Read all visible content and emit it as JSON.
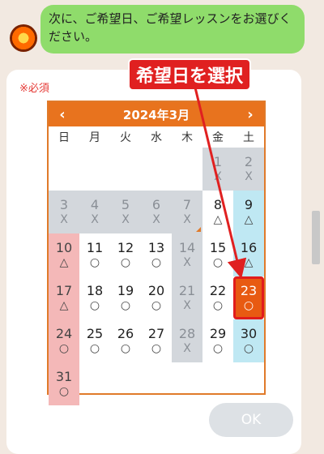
{
  "chat": {
    "message": "次に、ご希望日、ご希望レッスンをお選びください。"
  },
  "form": {
    "required_label": "※必須",
    "ok_label": "OK"
  },
  "annotation": {
    "callout": "希望日を選択"
  },
  "calendar": {
    "title": "2024年3月",
    "prev_label": "‹",
    "next_label": "›",
    "weekdays": [
      "日",
      "月",
      "火",
      "水",
      "木",
      "金",
      "土"
    ],
    "days": [
      {
        "day": "",
        "mark": "",
        "state": "empty"
      },
      {
        "day": "",
        "mark": "",
        "state": "empty"
      },
      {
        "day": "",
        "mark": "",
        "state": "empty"
      },
      {
        "day": "",
        "mark": "",
        "state": "empty"
      },
      {
        "day": "",
        "mark": "",
        "state": "empty"
      },
      {
        "day": "1",
        "mark": "X",
        "state": "gray"
      },
      {
        "day": "2",
        "mark": "X",
        "state": "gray"
      },
      {
        "day": "3",
        "mark": "X",
        "state": "gray"
      },
      {
        "day": "4",
        "mark": "X",
        "state": "gray"
      },
      {
        "day": "5",
        "mark": "X",
        "state": "gray"
      },
      {
        "day": "6",
        "mark": "X",
        "state": "gray"
      },
      {
        "day": "7",
        "mark": "X",
        "state": "gray",
        "corner": true
      },
      {
        "day": "8",
        "mark": "△",
        "state": "normal"
      },
      {
        "day": "9",
        "mark": "△",
        "state": "blue"
      },
      {
        "day": "10",
        "mark": "△",
        "state": "pink"
      },
      {
        "day": "11",
        "mark": "○",
        "state": "normal"
      },
      {
        "day": "12",
        "mark": "○",
        "state": "normal"
      },
      {
        "day": "13",
        "mark": "○",
        "state": "normal"
      },
      {
        "day": "14",
        "mark": "X",
        "state": "gray"
      },
      {
        "day": "15",
        "mark": "○",
        "state": "normal"
      },
      {
        "day": "16",
        "mark": "△",
        "state": "blue"
      },
      {
        "day": "17",
        "mark": "△",
        "state": "pink"
      },
      {
        "day": "18",
        "mark": "○",
        "state": "normal"
      },
      {
        "day": "19",
        "mark": "○",
        "state": "normal"
      },
      {
        "day": "20",
        "mark": "○",
        "state": "normal"
      },
      {
        "day": "21",
        "mark": "X",
        "state": "gray"
      },
      {
        "day": "22",
        "mark": "○",
        "state": "normal"
      },
      {
        "day": "23",
        "mark": "○",
        "state": "selected"
      },
      {
        "day": "24",
        "mark": "○",
        "state": "pink"
      },
      {
        "day": "25",
        "mark": "○",
        "state": "normal"
      },
      {
        "day": "26",
        "mark": "○",
        "state": "normal"
      },
      {
        "day": "27",
        "mark": "○",
        "state": "normal"
      },
      {
        "day": "28",
        "mark": "X",
        "state": "gray"
      },
      {
        "day": "29",
        "mark": "○",
        "state": "normal"
      },
      {
        "day": "30",
        "mark": "○",
        "state": "blue"
      },
      {
        "day": "31",
        "mark": "○",
        "state": "pink"
      }
    ]
  },
  "colors": {
    "accent": "#e8731e",
    "bubble": "#8fdc6b",
    "callout": "#e02020",
    "selected": "#e85a12"
  }
}
